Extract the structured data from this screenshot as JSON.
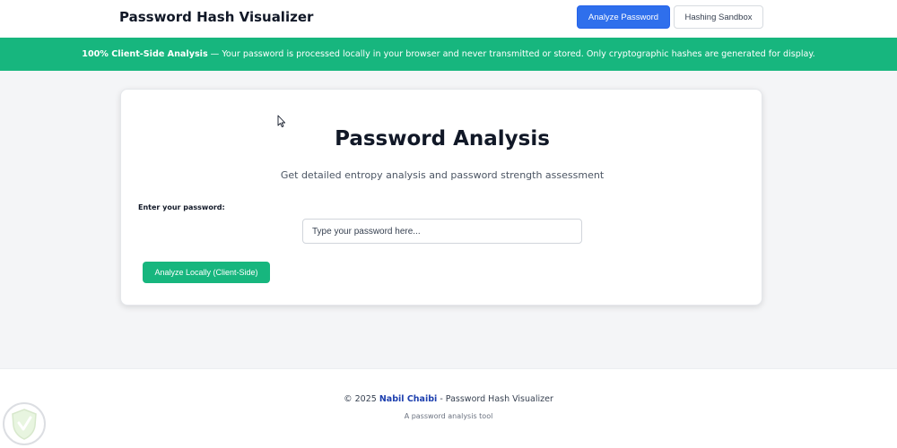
{
  "header": {
    "title": "Password Hash Visualizer",
    "nav": {
      "analyze_label": "Analyze Password",
      "sandbox_label": "Hashing Sandbox"
    }
  },
  "banner": {
    "bold": "100% Client-Side Analysis",
    "text": "— Your password is processed locally in your browser and never transmitted or stored. Only cryptographic hashes are generated for display."
  },
  "card": {
    "title": "Password Analysis",
    "subtitle": "Get detailed entropy analysis and password strength assessment",
    "field_label": "Enter your password:",
    "input_placeholder": "Type your password here...",
    "input_value": "",
    "button_label": "Analyze Locally (Client-Side)"
  },
  "footer": {
    "copyright": "© 2025",
    "author": "Nabil Chaibi",
    "suffix": "- Password Hash Visualizer",
    "tagline": "A password analysis tool"
  },
  "colors": {
    "primary": "#2f6fec",
    "success": "#17b67e",
    "author_link": "#1e40af"
  },
  "icons": {
    "cursor": "mouse-pointer-icon",
    "watermark": "shield-logo-icon"
  }
}
